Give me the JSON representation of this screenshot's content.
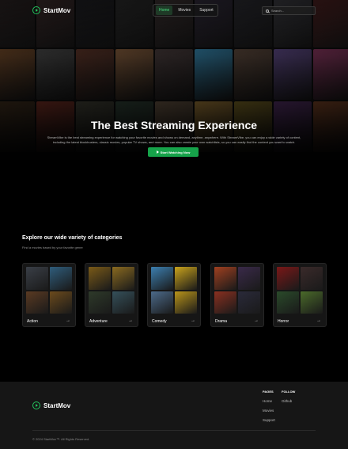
{
  "brand": {
    "name": "StartMov",
    "accent": "#22c55e"
  },
  "nav": {
    "links": [
      "Home",
      "Movies",
      "Support"
    ],
    "active": "Home",
    "search_placeholder": "Search..."
  },
  "hero": {
    "title": "The Best Streaming Experience",
    "description": "StreamVibe is the best streaming experience for watching your favorite movies and shows on demand, anytime, anywhere. With StreamVibe, you can enjoy a wide variety of content, including the latest blockbusters, classic movies, popular TV shows, and more. You can also create your own watchlists, so you can easily find the content you want to watch.",
    "cta_label": "Start Watching Now"
  },
  "categories": {
    "title": "Explore our wide variety of categories",
    "subtitle": "Find a movies based by your favorite genre",
    "items": [
      {
        "label": "Action",
        "colors": [
          "#3a3f47",
          "#2f5d7c",
          "#5a3a22",
          "#6b4a1c"
        ]
      },
      {
        "label": "Adventure",
        "colors": [
          "#7a5a18",
          "#8a6a20",
          "#2e3a2a",
          "#35505a"
        ]
      },
      {
        "label": "Comedy",
        "colors": [
          "#3c7fb0",
          "#c9a31c",
          "#4c6a8a",
          "#b8941a"
        ]
      },
      {
        "label": "Drama",
        "colors": [
          "#a04020",
          "#3a2a4a",
          "#8a3020",
          "#2a2a3a"
        ]
      },
      {
        "label": "Horror",
        "colors": [
          "#7a1818",
          "#3a2a2a",
          "#2a4a2a",
          "#4a6a2a"
        ]
      }
    ]
  },
  "footer": {
    "pages_title": "PAGES",
    "pages": [
      "Home",
      "Movies",
      "Support"
    ],
    "follow_title": "FOLLOW",
    "follow": [
      "Github"
    ],
    "copyright": "© 2024 StartMov™. All Rights Reserved."
  },
  "poster_colors": [
    "#2a2222",
    "#3a2a2a",
    "#1e1e22",
    "#2a2a2a",
    "#3a3030",
    "#302a3a",
    "#2a2a30",
    "#3a3a40",
    "#4a2020",
    "#5a3a20",
    "#3a3a3a",
    "#4a2a20",
    "#6a4a30",
    "#3a3030",
    "#2a6a8a",
    "#4a3a30",
    "#4a3a6a",
    "#6a2a4a",
    "#3a2a1a",
    "#6a2a20",
    "#3a3a30",
    "#2a3a30",
    "#5a4a3a",
    "#8a6a30",
    "#6a5a20",
    "#4a2a5a",
    "#6a3a20"
  ]
}
